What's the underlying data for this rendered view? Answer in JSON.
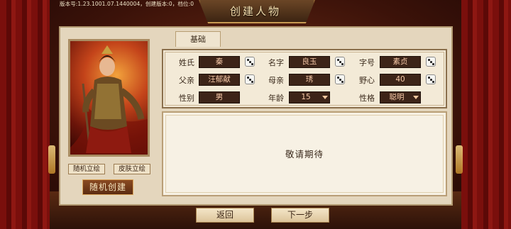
{
  "version_text": "版本号:1.23.1001.07.1440004，创建版本:0，档位:0",
  "title": "创建人物",
  "tab": "基础",
  "portrait_buttons": {
    "random_portrait": "随机立绘",
    "skin_portrait": "皮肤立绘"
  },
  "random_create": "随机创建",
  "attributes": {
    "surname": {
      "label": "姓氏",
      "value": "秦"
    },
    "given_name": {
      "label": "名字",
      "value": "良玉"
    },
    "courtesy_name": {
      "label": "字号",
      "value": "素贞"
    },
    "father": {
      "label": "父亲",
      "value": "汪郁献"
    },
    "mother": {
      "label": "母亲",
      "value": "琇"
    },
    "ambition": {
      "label": "野心",
      "value": "40"
    },
    "gender": {
      "label": "性别",
      "value": "男"
    },
    "age": {
      "label": "年龄",
      "value": "15"
    },
    "personality": {
      "label": "性格",
      "value": "聪明"
    }
  },
  "description": "敬请期待",
  "nav": {
    "back": "返回",
    "next": "下一步"
  },
  "colors": {
    "value_bg": "#3d2418",
    "value_text": "#f7c9a8",
    "panel": "#e4d6bd",
    "accent": "#8a4a22"
  },
  "icons": [
    "dice-icon",
    "dropdown-arrow-icon"
  ]
}
